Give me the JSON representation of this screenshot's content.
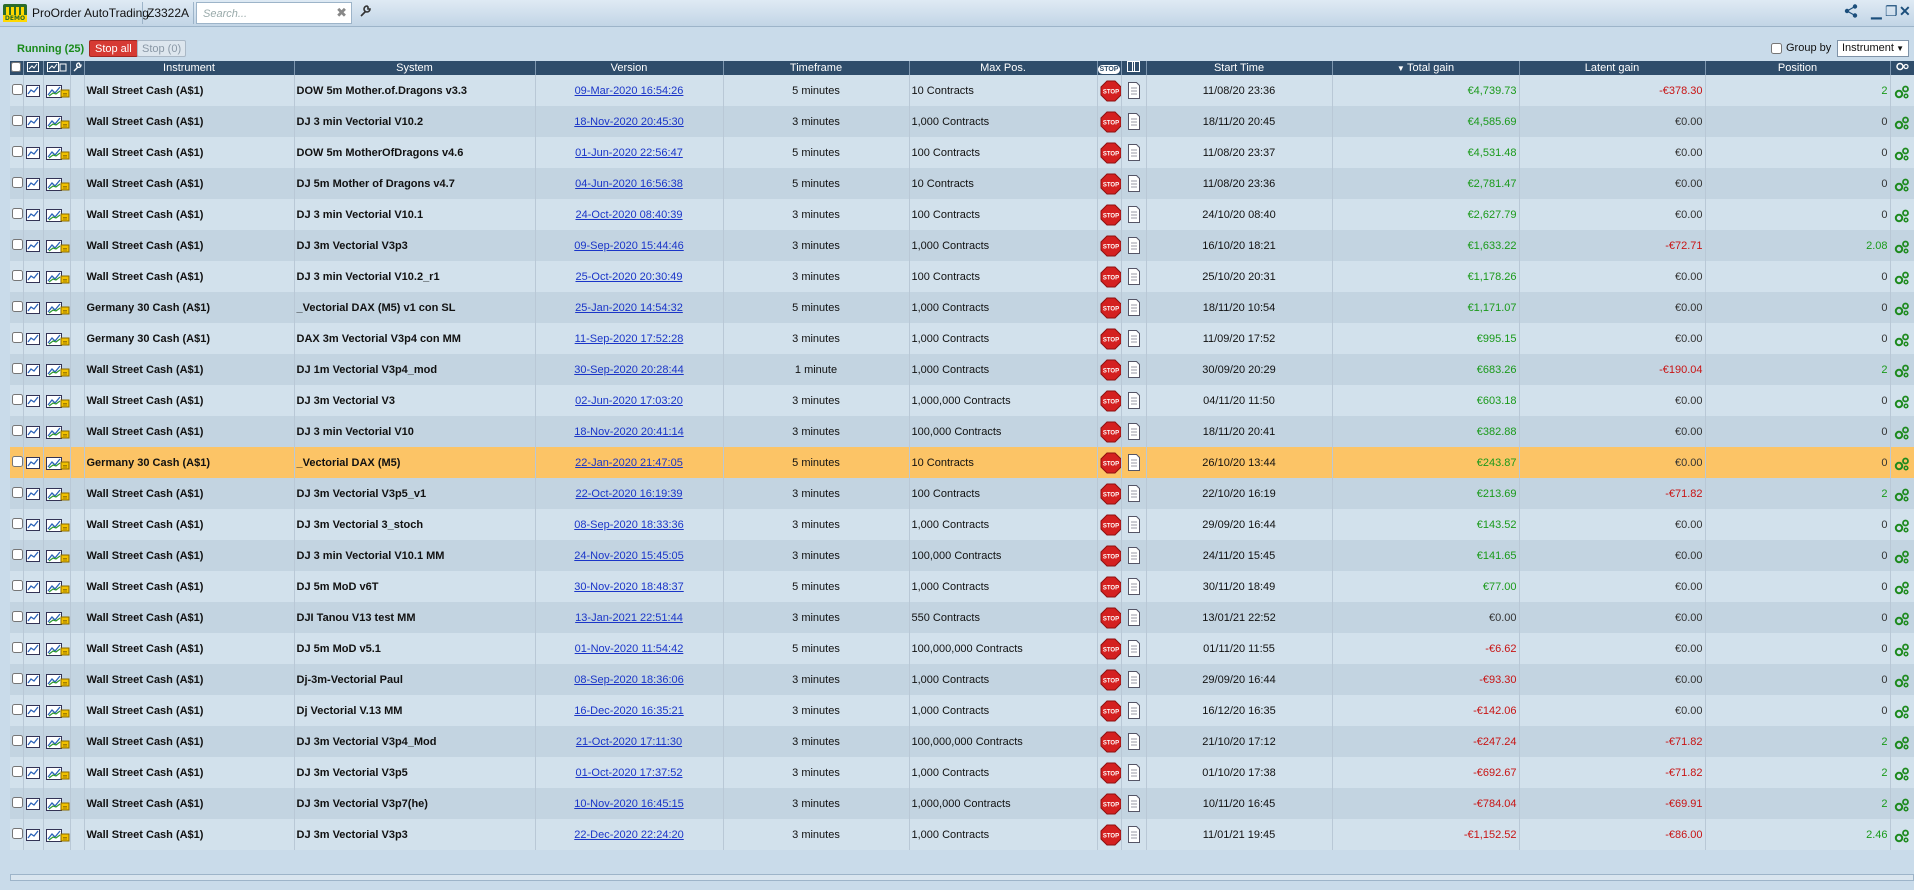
{
  "app": {
    "title": "ProOrder AutoTrading",
    "logo_text": "DEMO",
    "account": "Z3322A",
    "search_placeholder": "Search..."
  },
  "toolbar": {
    "running_label": "Running (25)",
    "stop_all_label": "Stop all",
    "stop_count_label": "Stop (0)",
    "group_by_label": "Group by",
    "group_by_value": "Instrument"
  },
  "columns": {
    "instrument": "Instrument",
    "system": "System",
    "version": "Version",
    "timeframe": "Timeframe",
    "max_pos": "Max Pos.",
    "stop": "STOP",
    "start_time": "Start Time",
    "total_gain": "Total gain",
    "latent_gain": "Latent gain",
    "position": "Position"
  },
  "colors": {
    "positive": "#1a9a1a",
    "negative": "#c81414",
    "header": "#2f4d6b",
    "highlight": "#fcc466"
  },
  "rows": [
    {
      "instrument": "Wall Street Cash (A$1)",
      "system": "DOW 5m Mother.of.Dragons v3.3",
      "version": "09-Mar-2020 16:54:26",
      "timeframe": "5 minutes",
      "max_pos": "10 Contracts",
      "start": "11/08/20 23:36",
      "total": "€4,739.73",
      "total_sign": "pos",
      "latent": "-€378.30",
      "latent_sign": "neg",
      "position": "2",
      "position_sign": "pos"
    },
    {
      "instrument": "Wall Street Cash (A$1)",
      "system": "DJ 3 min Vectorial V10.2",
      "version": "18-Nov-2020 20:45:30",
      "timeframe": "3 minutes",
      "max_pos": "1,000 Contracts",
      "start": "18/11/20 20:45",
      "total": "€4,585.69",
      "total_sign": "pos",
      "latent": "€0.00",
      "latent_sign": "zero",
      "position": "0",
      "position_sign": "zero"
    },
    {
      "instrument": "Wall Street Cash (A$1)",
      "system": "DOW 5m MotherOfDragons v4.6",
      "version": "01-Jun-2020 22:56:47",
      "timeframe": "5 minutes",
      "max_pos": "100 Contracts",
      "start": "11/08/20 23:37",
      "total": "€4,531.48",
      "total_sign": "pos",
      "latent": "€0.00",
      "latent_sign": "zero",
      "position": "0",
      "position_sign": "zero"
    },
    {
      "instrument": "Wall Street Cash (A$1)",
      "system": "DJ 5m Mother of Dragons v4.7",
      "version": "04-Jun-2020 16:56:38",
      "timeframe": "5 minutes",
      "max_pos": "10 Contracts",
      "start": "11/08/20 23:36",
      "total": "€2,781.47",
      "total_sign": "pos",
      "latent": "€0.00",
      "latent_sign": "zero",
      "position": "0",
      "position_sign": "zero"
    },
    {
      "instrument": "Wall Street Cash (A$1)",
      "system": "DJ 3 min Vectorial V10.1",
      "version": "24-Oct-2020 08:40:39",
      "timeframe": "3 minutes",
      "max_pos": "100 Contracts",
      "start": "24/10/20 08:40",
      "total": "€2,627.79",
      "total_sign": "pos",
      "latent": "€0.00",
      "latent_sign": "zero",
      "position": "0",
      "position_sign": "zero"
    },
    {
      "instrument": "Wall Street Cash (A$1)",
      "system": "DJ 3m Vectorial V3p3",
      "version": "09-Sep-2020 15:44:46",
      "timeframe": "3 minutes",
      "max_pos": "1,000 Contracts",
      "start": "16/10/20 18:21",
      "total": "€1,633.22",
      "total_sign": "pos",
      "latent": "-€72.71",
      "latent_sign": "neg",
      "position": "2.08",
      "position_sign": "pos"
    },
    {
      "instrument": "Wall Street Cash (A$1)",
      "system": "DJ 3 min Vectorial V10.2_r1",
      "version": "25-Oct-2020 20:30:49",
      "timeframe": "3 minutes",
      "max_pos": "100 Contracts",
      "start": "25/10/20 20:31",
      "total": "€1,178.26",
      "total_sign": "pos",
      "latent": "€0.00",
      "latent_sign": "zero",
      "position": "0",
      "position_sign": "zero"
    },
    {
      "instrument": "Germany 30 Cash (A$1)",
      "system": "_Vectorial DAX (M5) v1 con SL",
      "version": "25-Jan-2020 14:54:32",
      "timeframe": "5 minutes",
      "max_pos": "1,000 Contracts",
      "start": "18/11/20 10:54",
      "total": "€1,171.07",
      "total_sign": "pos",
      "latent": "€0.00",
      "latent_sign": "zero",
      "position": "0",
      "position_sign": "zero"
    },
    {
      "instrument": "Germany 30 Cash (A$1)",
      "system": "DAX 3m Vectorial V3p4 con MM",
      "version": "11-Sep-2020 17:52:28",
      "timeframe": "3 minutes",
      "max_pos": "1,000 Contracts",
      "start": "11/09/20 17:52",
      "total": "€995.15",
      "total_sign": "pos",
      "latent": "€0.00",
      "latent_sign": "zero",
      "position": "0",
      "position_sign": "zero"
    },
    {
      "instrument": "Wall Street Cash (A$1)",
      "system": "DJ 1m Vectorial V3p4_mod",
      "version": "30-Sep-2020 20:28:44",
      "timeframe": "1 minute",
      "max_pos": "1,000 Contracts",
      "start": "30/09/20 20:29",
      "total": "€683.26",
      "total_sign": "pos",
      "latent": "-€190.04",
      "latent_sign": "neg",
      "position": "2",
      "position_sign": "pos"
    },
    {
      "instrument": "Wall Street Cash (A$1)",
      "system": "DJ 3m Vectorial V3",
      "version": "02-Jun-2020 17:03:20",
      "timeframe": "3 minutes",
      "max_pos": "1,000,000 Contracts",
      "start": "04/11/20 11:50",
      "total": "€603.18",
      "total_sign": "pos",
      "latent": "€0.00",
      "latent_sign": "zero",
      "position": "0",
      "position_sign": "zero"
    },
    {
      "instrument": "Wall Street Cash (A$1)",
      "system": "DJ 3 min Vectorial V10",
      "version": "18-Nov-2020 20:41:14",
      "timeframe": "3 minutes",
      "max_pos": "100,000 Contracts",
      "start": "18/11/20 20:41",
      "total": "€382.88",
      "total_sign": "pos",
      "latent": "€0.00",
      "latent_sign": "zero",
      "position": "0",
      "position_sign": "zero"
    },
    {
      "instrument": "Germany 30 Cash (A$1)",
      "system": "_Vectorial DAX (M5)",
      "version": "22-Jan-2020 21:47:05",
      "timeframe": "5 minutes",
      "max_pos": "10 Contracts",
      "start": "26/10/20 13:44",
      "total": "€243.87",
      "total_sign": "pos",
      "latent": "€0.00",
      "latent_sign": "zero",
      "position": "0",
      "position_sign": "zero",
      "highlight": true
    },
    {
      "instrument": "Wall Street Cash (A$1)",
      "system": "DJ 3m Vectorial V3p5_v1",
      "version": "22-Oct-2020 16:19:39",
      "timeframe": "3 minutes",
      "max_pos": "100 Contracts",
      "start": "22/10/20 16:19",
      "total": "€213.69",
      "total_sign": "pos",
      "latent": "-€71.82",
      "latent_sign": "neg",
      "position": "2",
      "position_sign": "pos"
    },
    {
      "instrument": "Wall Street Cash (A$1)",
      "system": "DJ 3m Vectorial 3_stoch",
      "version": "08-Sep-2020 18:33:36",
      "timeframe": "3 minutes",
      "max_pos": "1,000 Contracts",
      "start": "29/09/20 16:44",
      "total": "€143.52",
      "total_sign": "pos",
      "latent": "€0.00",
      "latent_sign": "zero",
      "position": "0",
      "position_sign": "zero"
    },
    {
      "instrument": "Wall Street Cash (A$1)",
      "system": "DJ 3 min Vectorial V10.1 MM",
      "version": "24-Nov-2020 15:45:05",
      "timeframe": "3 minutes",
      "max_pos": "100,000 Contracts",
      "start": "24/11/20 15:45",
      "total": "€141.65",
      "total_sign": "pos",
      "latent": "€0.00",
      "latent_sign": "zero",
      "position": "0",
      "position_sign": "zero"
    },
    {
      "instrument": "Wall Street Cash (A$1)",
      "system": "DJ 5m MoD v6T",
      "version": "30-Nov-2020 18:48:37",
      "timeframe": "5 minutes",
      "max_pos": "1,000 Contracts",
      "start": "30/11/20 18:49",
      "total": "€77.00",
      "total_sign": "pos",
      "latent": "€0.00",
      "latent_sign": "zero",
      "position": "0",
      "position_sign": "zero"
    },
    {
      "instrument": "Wall Street Cash (A$1)",
      "system": "DJI Tanou V13 test MM",
      "version": "13-Jan-2021 22:51:44",
      "timeframe": "3 minutes",
      "max_pos": "550 Contracts",
      "start": "13/01/21 22:52",
      "total": "€0.00",
      "total_sign": "zero",
      "latent": "€0.00",
      "latent_sign": "zero",
      "position": "0",
      "position_sign": "zero"
    },
    {
      "instrument": "Wall Street Cash (A$1)",
      "system": "DJ 5m MoD v5.1",
      "version": "01-Nov-2020 11:54:42",
      "timeframe": "5 minutes",
      "max_pos": "100,000,000 Contracts",
      "start": "01/11/20 11:55",
      "total": "-€6.62",
      "total_sign": "neg",
      "latent": "€0.00",
      "latent_sign": "zero",
      "position": "0",
      "position_sign": "zero"
    },
    {
      "instrument": "Wall Street Cash (A$1)",
      "system": "Dj-3m-Vectorial Paul",
      "version": "08-Sep-2020 18:36:06",
      "timeframe": "3 minutes",
      "max_pos": "1,000 Contracts",
      "start": "29/09/20 16:44",
      "total": "-€93.30",
      "total_sign": "neg",
      "latent": "€0.00",
      "latent_sign": "zero",
      "position": "0",
      "position_sign": "zero"
    },
    {
      "instrument": "Wall Street Cash (A$1)",
      "system": "Dj Vectorial V.13 MM",
      "version": "16-Dec-2020 16:35:21",
      "timeframe": "3 minutes",
      "max_pos": "1,000 Contracts",
      "start": "16/12/20 16:35",
      "total": "-€142.06",
      "total_sign": "neg",
      "latent": "€0.00",
      "latent_sign": "zero",
      "position": "0",
      "position_sign": "zero"
    },
    {
      "instrument": "Wall Street Cash (A$1)",
      "system": "DJ 3m Vectorial V3p4_Mod",
      "version": "21-Oct-2020 17:11:30",
      "timeframe": "3 minutes",
      "max_pos": "100,000,000 Contracts",
      "start": "21/10/20 17:12",
      "total": "-€247.24",
      "total_sign": "neg",
      "latent": "-€71.82",
      "latent_sign": "neg",
      "position": "2",
      "position_sign": "pos"
    },
    {
      "instrument": "Wall Street Cash (A$1)",
      "system": "DJ 3m Vectorial V3p5",
      "version": "01-Oct-2020 17:37:52",
      "timeframe": "3 minutes",
      "max_pos": "1,000 Contracts",
      "start": "01/10/20 17:38",
      "total": "-€692.67",
      "total_sign": "neg",
      "latent": "-€71.82",
      "latent_sign": "neg",
      "position": "2",
      "position_sign": "pos"
    },
    {
      "instrument": "Wall Street Cash (A$1)",
      "system": "DJ 3m Vectorial V3p7(he)",
      "version": "10-Nov-2020 16:45:15",
      "timeframe": "3 minutes",
      "max_pos": "1,000,000 Contracts",
      "start": "10/11/20 16:45",
      "total": "-€784.04",
      "total_sign": "neg",
      "latent": "-€69.91",
      "latent_sign": "neg",
      "position": "2",
      "position_sign": "pos"
    },
    {
      "instrument": "Wall Street Cash (A$1)",
      "system": "DJ 3m Vectorial V3p3",
      "version": "22-Dec-2020 22:24:20",
      "timeframe": "3 minutes",
      "max_pos": "1,000 Contracts",
      "start": "11/01/21 19:45",
      "total": "-€1,152.52",
      "total_sign": "neg",
      "latent": "-€86.00",
      "latent_sign": "neg",
      "position": "2.46",
      "position_sign": "pos"
    }
  ]
}
